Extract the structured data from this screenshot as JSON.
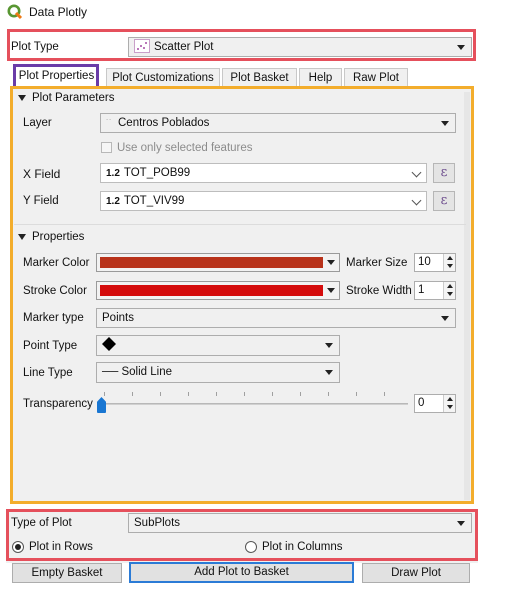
{
  "window": {
    "title": "Data Plotly"
  },
  "plot_type": {
    "label": "Plot Type",
    "value": "Scatter Plot"
  },
  "tabs": [
    {
      "label": "Plot Properties"
    },
    {
      "label": "Plot Customizations"
    },
    {
      "label": "Plot Basket"
    },
    {
      "label": "Help"
    },
    {
      "label": "Raw Plot"
    }
  ],
  "params": {
    "header": "Plot Parameters",
    "layer_label": "Layer",
    "layer_value": "Centros Poblados",
    "selected_only_label": "Use only selected features",
    "x_label": "X Field",
    "x_type": "1.2",
    "x_value": "TOT_POB99",
    "y_label": "Y Field",
    "y_type": "1.2",
    "y_value": "TOT_VIV99",
    "expr_symbol": "ε"
  },
  "properties": {
    "header": "Properties",
    "marker_color_label": "Marker Color",
    "marker_color": "#b8321a",
    "stroke_color_label": "Stroke Color",
    "stroke_color": "#d40b0b",
    "marker_size_label": "Marker Size",
    "marker_size": "10",
    "stroke_width_label": "Stroke Width",
    "stroke_width": "1",
    "marker_type_label": "Marker type",
    "marker_type": "Points",
    "point_type_label": "Point Type",
    "point_type_icon": "diamond-icon",
    "line_type_label": "Line Type",
    "line_type": "── Solid Line",
    "transparency_label": "Transparency",
    "transparency": "0"
  },
  "footer": {
    "type_of_plot_label": "Type of Plot",
    "type_of_plot": "SubPlots",
    "rows_label": "Plot in Rows",
    "columns_label": "Plot in Columns",
    "rows_selected": true
  },
  "buttons": {
    "empty_basket": "Empty Basket",
    "add_plot": "Add Plot to Basket",
    "draw_plot": "Draw Plot"
  },
  "colors": {
    "highlight_red": "#e5505c",
    "highlight_orange": "#f3ad2c",
    "highlight_purple": "#6a3ca8",
    "accent_blue": "#1976d2"
  }
}
